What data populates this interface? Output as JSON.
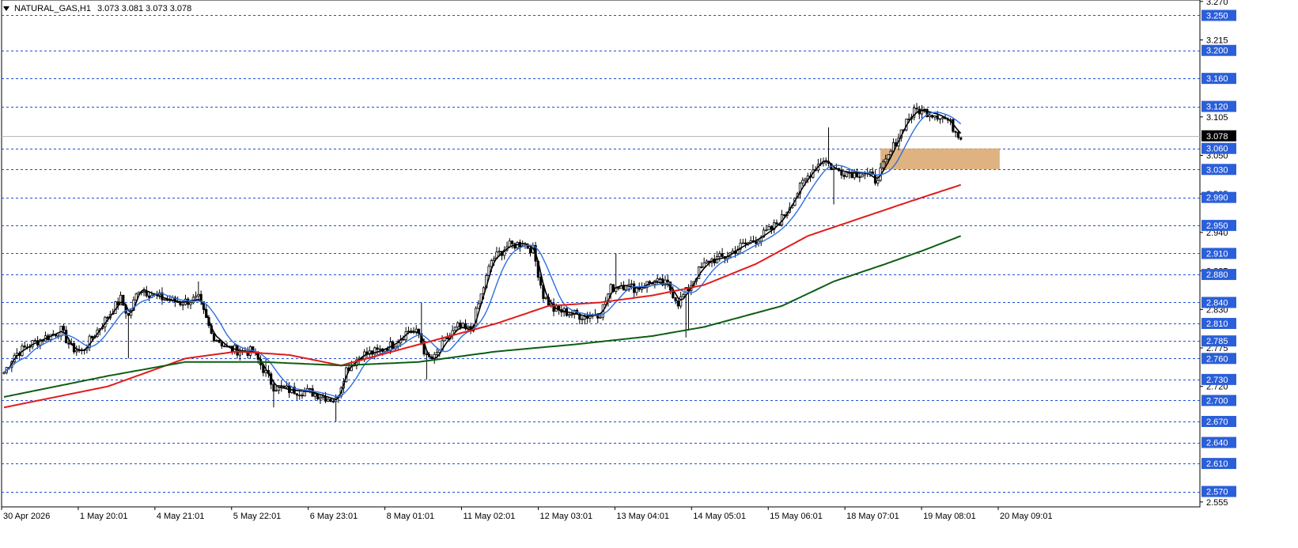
{
  "header": {
    "symbol": "NATURAL_GAS,H1",
    "ohlc": "3.073 3.081 3.073 3.078"
  },
  "colors": {
    "background": "#ffffff",
    "candle": "#000000",
    "level_line": "#1f4fd6",
    "level_label_bg": "#2b5fd9",
    "price_label_bg": "#000000",
    "zone": "#d9a66b",
    "ma_black": "#000000",
    "ma_blue": "#2e6fe0",
    "ma_red": "#e21b1b",
    "ma_green": "#0c5e12"
  },
  "chart_data": {
    "type": "candlestick",
    "title": "NATURAL_GAS,H1",
    "ylim": [
      2.548,
      3.272
    ],
    "y_ticks": [
      "3.270",
      "3.215",
      "3.105",
      "3.050",
      "2.995",
      "2.940",
      "2.885",
      "2.830",
      "2.775",
      "2.720",
      "2.555"
    ],
    "x_ticks": [
      "30 Apr 2026",
      "1 May 20:01",
      "4 May 21:01",
      "5 May 22:01",
      "6 May 23:01",
      "8 May 01:01",
      "11 May 02:01",
      "12 May 03:01",
      "13 May 04:01",
      "14 May 05:01",
      "15 May 06:01",
      "18 May 07:01",
      "19 May 08:01",
      "20 May 09:01"
    ],
    "current_price": "3.078",
    "levels": [
      "3.250",
      "3.200",
      "3.160",
      "3.120",
      "3.060",
      "3.030",
      "2.990",
      "2.950",
      "2.910",
      "2.880",
      "2.840",
      "2.810",
      "2.785",
      "2.760",
      "2.730",
      "2.700",
      "2.670",
      "2.640",
      "2.610",
      "2.570"
    ],
    "zone": {
      "from_price": 3.03,
      "to_price": 3.06,
      "start_bar": 338,
      "end_bar": 384
    },
    "bars_total": 370,
    "close_path": [
      [
        0,
        2.74
      ],
      [
        4,
        2.765
      ],
      [
        10,
        2.78
      ],
      [
        16,
        2.79
      ],
      [
        22,
        2.8
      ],
      [
        26,
        2.775
      ],
      [
        30,
        2.77
      ],
      [
        34,
        2.79
      ],
      [
        40,
        2.82
      ],
      [
        45,
        2.845
      ],
      [
        48,
        2.82
      ],
      [
        52,
        2.86
      ],
      [
        58,
        2.85
      ],
      [
        62,
        2.845
      ],
      [
        68,
        2.84
      ],
      [
        75,
        2.845
      ],
      [
        80,
        2.795
      ],
      [
        86,
        2.775
      ],
      [
        92,
        2.77
      ],
      [
        96,
        2.77
      ],
      [
        100,
        2.745
      ],
      [
        104,
        2.72
      ],
      [
        110,
        2.715
      ],
      [
        118,
        2.712
      ],
      [
        124,
        2.705
      ],
      [
        128,
        2.7
      ],
      [
        132,
        2.745
      ],
      [
        138,
        2.765
      ],
      [
        144,
        2.77
      ],
      [
        150,
        2.78
      ],
      [
        156,
        2.8
      ],
      [
        160,
        2.795
      ],
      [
        163,
        2.76
      ],
      [
        166,
        2.76
      ],
      [
        170,
        2.785
      ],
      [
        175,
        2.805
      ],
      [
        180,
        2.8
      ],
      [
        184,
        2.85
      ],
      [
        188,
        2.9
      ],
      [
        194,
        2.92
      ],
      [
        200,
        2.925
      ],
      [
        204,
        2.915
      ],
      [
        208,
        2.85
      ],
      [
        212,
        2.83
      ],
      [
        218,
        2.825
      ],
      [
        224,
        2.82
      ],
      [
        230,
        2.825
      ],
      [
        234,
        2.86
      ],
      [
        238,
        2.865
      ],
      [
        244,
        2.86
      ],
      [
        250,
        2.87
      ],
      [
        256,
        2.865
      ],
      [
        260,
        2.84
      ],
      [
        264,
        2.86
      ],
      [
        268,
        2.885
      ],
      [
        272,
        2.9
      ],
      [
        278,
        2.905
      ],
      [
        284,
        2.92
      ],
      [
        290,
        2.93
      ],
      [
        296,
        2.945
      ],
      [
        300,
        2.96
      ],
      [
        304,
        2.985
      ],
      [
        308,
        3.01
      ],
      [
        312,
        3.03
      ],
      [
        316,
        3.045
      ],
      [
        320,
        3.03
      ],
      [
        326,
        3.025
      ],
      [
        332,
        3.025
      ],
      [
        336,
        3.015
      ],
      [
        340,
        3.04
      ],
      [
        344,
        3.07
      ],
      [
        348,
        3.1
      ],
      [
        352,
        3.115
      ],
      [
        356,
        3.112
      ],
      [
        360,
        3.108
      ],
      [
        364,
        3.1
      ],
      [
        367,
        3.085
      ],
      [
        369,
        3.078
      ]
    ],
    "high_spikes": [
      [
        75,
        2.87
      ],
      [
        101,
        2.76
      ],
      [
        161,
        2.84
      ],
      [
        236,
        2.91
      ],
      [
        263,
        2.79
      ],
      [
        318,
        3.09
      ]
    ],
    "low_spikes": [
      [
        48,
        2.76
      ],
      [
        104,
        2.69
      ],
      [
        128,
        2.67
      ],
      [
        163,
        2.73
      ],
      [
        264,
        2.8
      ],
      [
        320,
        2.98
      ]
    ],
    "moving_averages": [
      {
        "name": "fast",
        "color": "#000000",
        "period": 3,
        "width": 1.6
      },
      {
        "name": "mid",
        "color": "#2e6fe0",
        "period": 10,
        "width": 1.4
      },
      {
        "name": "slow",
        "color": "#e21b1b",
        "anchor_path": [
          [
            0,
            2.69
          ],
          [
            40,
            2.72
          ],
          [
            70,
            2.76
          ],
          [
            90,
            2.77
          ],
          [
            110,
            2.765
          ],
          [
            130,
            2.75
          ],
          [
            150,
            2.77
          ],
          [
            170,
            2.79
          ],
          [
            190,
            2.81
          ],
          [
            210,
            2.835
          ],
          [
            230,
            2.84
          ],
          [
            250,
            2.85
          ],
          [
            270,
            2.865
          ],
          [
            290,
            2.895
          ],
          [
            310,
            2.935
          ],
          [
            330,
            2.96
          ],
          [
            350,
            2.985
          ],
          [
            369,
            3.008
          ]
        ],
        "width": 2
      },
      {
        "name": "long",
        "color": "#0c5e12",
        "anchor_path": [
          [
            0,
            2.705
          ],
          [
            40,
            2.735
          ],
          [
            70,
            2.755
          ],
          [
            100,
            2.755
          ],
          [
            130,
            2.75
          ],
          [
            160,
            2.755
          ],
          [
            190,
            2.77
          ],
          [
            220,
            2.78
          ],
          [
            250,
            2.792
          ],
          [
            270,
            2.805
          ],
          [
            300,
            2.835
          ],
          [
            320,
            2.87
          ],
          [
            340,
            2.895
          ],
          [
            355,
            2.915
          ],
          [
            369,
            2.935
          ]
        ],
        "width": 2
      }
    ]
  }
}
